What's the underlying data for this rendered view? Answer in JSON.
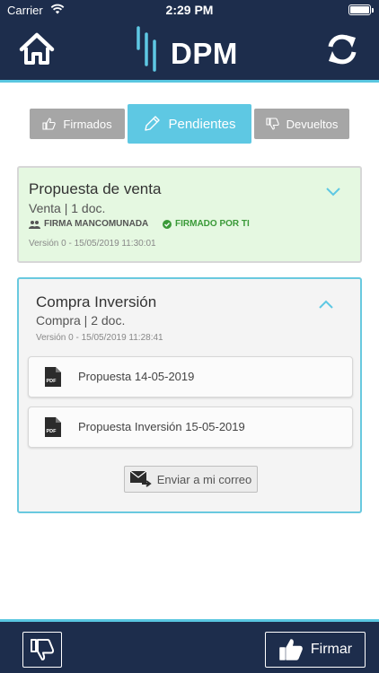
{
  "status_bar": {
    "carrier": "Carrier",
    "time": "2:29 PM"
  },
  "header": {
    "logo_text": "DPM",
    "home_icon": "home-icon",
    "refresh_icon": "refresh-icon"
  },
  "tabs": [
    {
      "label": "Firmados",
      "icon": "thumbs-up-icon",
      "active": false
    },
    {
      "label": "Pendientes",
      "icon": "pencil-icon",
      "active": true
    },
    {
      "label": "Devueltos",
      "icon": "thumbs-down-icon",
      "active": false
    }
  ],
  "cards": [
    {
      "title": "Propuesta de venta",
      "subtitle": "Venta | 1 doc.",
      "tags": [
        {
          "label": "FIRMA MANCOMUNADA",
          "icon": "group-icon"
        },
        {
          "label": "FIRMADO POR TI",
          "icon": "check-circle-icon"
        }
      ],
      "version": "Versión 0 - 15/05/2019 11:30:01",
      "expanded": false
    },
    {
      "title": "Compra Inversión",
      "subtitle": "Compra | 2 doc.",
      "version": "Versión 0 - 15/05/2019 11:28:41",
      "expanded": true,
      "documents": [
        {
          "label": "Propuesta 14-05-2019",
          "icon": "pdf-icon"
        },
        {
          "label": "Propuesta Inversión 15-05-2019",
          "icon": "pdf-icon"
        }
      ],
      "mail_button": "Enviar a mi correo"
    }
  ],
  "footer": {
    "reject_icon": "thumbs-down-icon",
    "sign_label": "Firmar",
    "sign_icon": "thumbs-up-icon"
  },
  "colors": {
    "navy": "#1d2d4c",
    "accent": "#5ec8e3",
    "signed_green": "#3a9a38",
    "card_signed_bg": "#e5f8e1"
  }
}
